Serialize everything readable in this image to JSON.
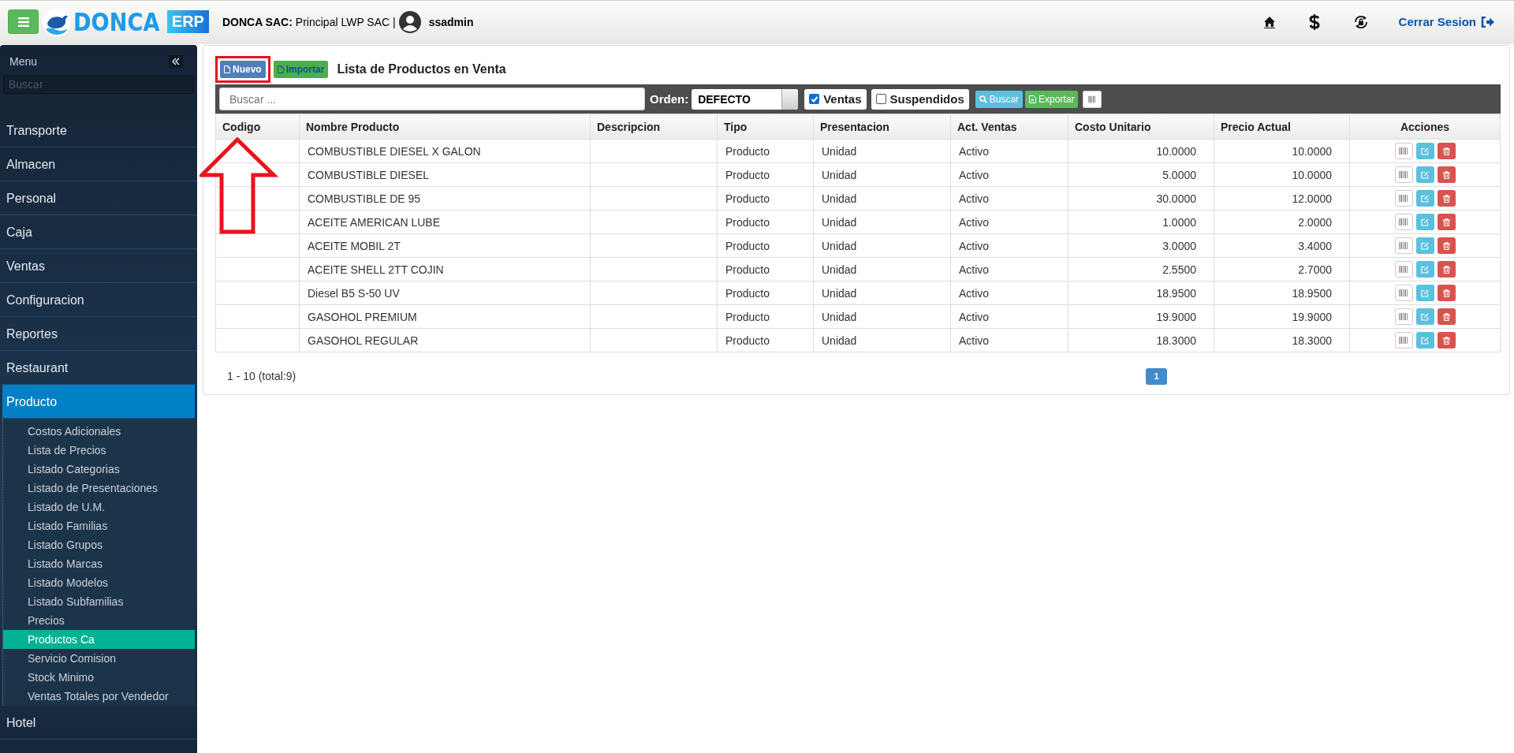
{
  "header": {
    "brand": "DONCA",
    "brand_badge": "ERP",
    "company_label": "DONCA SAC:",
    "company": "Principal LWP SAC |",
    "user": "ssadmin",
    "logout": "Cerrar Sesion"
  },
  "sidebar": {
    "title": "Menu",
    "search_placeholder": "Buscar",
    "items": [
      {
        "label": "Transporte",
        "expanded": false
      },
      {
        "label": "Almacen",
        "expanded": false
      },
      {
        "label": "Personal",
        "expanded": false
      },
      {
        "label": "Caja",
        "expanded": false
      },
      {
        "label": "Ventas",
        "expanded": false
      },
      {
        "label": "Configuracion",
        "expanded": false
      },
      {
        "label": "Reportes",
        "expanded": false
      },
      {
        "label": "Restaurant",
        "expanded": false
      },
      {
        "label": "Producto",
        "expanded": true,
        "children": [
          {
            "label": "Costos Adicionales",
            "selected": false
          },
          {
            "label": "Lista de Precios",
            "selected": false
          },
          {
            "label": "Listado Categorias",
            "selected": false
          },
          {
            "label": "Listado de Presentaciones",
            "selected": false
          },
          {
            "label": "Listado de U.M.",
            "selected": false
          },
          {
            "label": "Listado Familias",
            "selected": false
          },
          {
            "label": "Listado Grupos",
            "selected": false
          },
          {
            "label": "Listado Marcas",
            "selected": false
          },
          {
            "label": "Listado Modelos",
            "selected": false
          },
          {
            "label": "Listado Subfamilias",
            "selected": false
          },
          {
            "label": "Precios",
            "selected": false
          },
          {
            "label": "Productos Ca",
            "selected": true
          },
          {
            "label": "Servicio Comision",
            "selected": false
          },
          {
            "label": "Stock Minimo",
            "selected": false
          },
          {
            "label": "Ventas Totales por Vendedor",
            "selected": false
          }
        ]
      },
      {
        "label": "Hotel",
        "expanded": false
      }
    ]
  },
  "page": {
    "title": "Lista de Productos en Venta",
    "actions": [
      {
        "kind": "new",
        "label": "Nuevo",
        "highlighted": true
      },
      {
        "kind": "import",
        "label": "Importar",
        "highlighted": false
      }
    ],
    "filters": {
      "search_placeholder": "Buscar ...",
      "order_label": "Orden:",
      "order_value": "DEFECTO",
      "checkboxes": [
        {
          "label": "Ventas",
          "checked": true
        },
        {
          "label": "Suspendidos",
          "checked": false
        }
      ],
      "buttons": [
        {
          "kind": "search",
          "label": "Buscar"
        },
        {
          "kind": "export",
          "label": "Exportar"
        },
        {
          "kind": "barcode"
        }
      ]
    },
    "table": {
      "columns": [
        "Codigo",
        "Nombre Producto",
        "Descripcion",
        "Tipo",
        "Presentacion",
        "Act. Ventas",
        "Costo Unitario",
        "Precio Actual",
        "Acciones"
      ],
      "rows": [
        {
          "nombre": "COMBUSTIBLE DIESEL X GALON",
          "tipo": "Producto",
          "presentacion": "Unidad",
          "act_ventas": "Activo",
          "costo": "10.0000",
          "precio": "10.0000"
        },
        {
          "nombre": "COMBUSTIBLE DIESEL",
          "tipo": "Producto",
          "presentacion": "Unidad",
          "act_ventas": "Activo",
          "costo": "5.0000",
          "precio": "10.0000"
        },
        {
          "nombre": "COMBUSTIBLE DE 95",
          "tipo": "Producto",
          "presentacion": "Unidad",
          "act_ventas": "Activo",
          "costo": "30.0000",
          "precio": "12.0000"
        },
        {
          "nombre": "ACEITE AMERICAN LUBE",
          "tipo": "Producto",
          "presentacion": "Unidad",
          "act_ventas": "Activo",
          "costo": "1.0000",
          "precio": "2.0000"
        },
        {
          "nombre": "ACEITE MOBIL 2T",
          "tipo": "Producto",
          "presentacion": "Unidad",
          "act_ventas": "Activo",
          "costo": "3.0000",
          "precio": "3.4000"
        },
        {
          "nombre": "ACEITE SHELL 2TT COJIN",
          "tipo": "Producto",
          "presentacion": "Unidad",
          "act_ventas": "Activo",
          "costo": "2.5500",
          "precio": "2.7000"
        },
        {
          "nombre": "Diesel B5 S-50 UV",
          "tipo": "Producto",
          "presentacion": "Unidad",
          "act_ventas": "Activo",
          "costo": "18.9500",
          "precio": "18.9500"
        },
        {
          "nombre": "GASOHOL PREMIUM",
          "tipo": "Producto",
          "presentacion": "Unidad",
          "act_ventas": "Activo",
          "costo": "19.9000",
          "precio": "19.9000"
        },
        {
          "nombre": "GASOHOL REGULAR",
          "tipo": "Producto",
          "presentacion": "Unidad",
          "act_ventas": "Activo",
          "costo": "18.3000",
          "precio": "18.3000"
        }
      ]
    },
    "pagination": {
      "summary": "1 - 10 (total:9)",
      "pages": [
        {
          "label": "1",
          "selected": true
        }
      ]
    }
  }
}
